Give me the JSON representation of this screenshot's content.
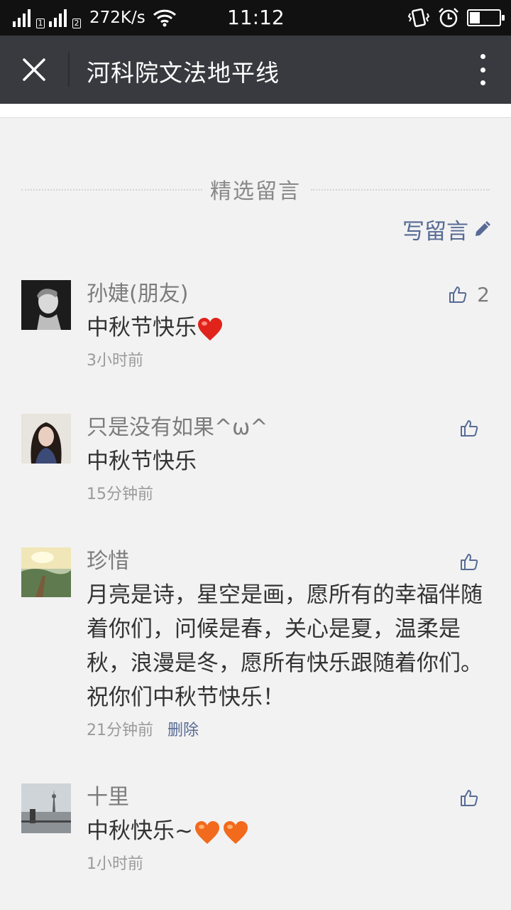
{
  "status_bar": {
    "sim1": "1",
    "sim2": "2",
    "speed": "272K/s",
    "time": "11:12",
    "battery_level": 0.35
  },
  "title_bar": {
    "title": "河科院文法地平线",
    "close_icon": "close-icon",
    "more_icon": "more-vertical-icon"
  },
  "section": {
    "title": "精选留言",
    "write_label": "写留言",
    "write_icon": "pencil-icon"
  },
  "comments": [
    {
      "name": "孙婕(朋友)",
      "text": "中秋节快乐",
      "time": "3小时前",
      "likes": "2",
      "emoji": "heart-red"
    },
    {
      "name": "只是没有如果^ω^",
      "text": "中秋节快乐",
      "time": "15分钟前",
      "likes": ""
    },
    {
      "name": "珍惜",
      "text": "月亮是诗，星空是画，愿所有的幸福伴随着你们，问候是春，关心是夏，温柔是秋，浪漫是冬，愿所有快乐跟随着你们。祝你们中秋节快乐！",
      "time": "21分钟前",
      "likes": "",
      "delete_label": "删除"
    },
    {
      "name": "十里",
      "text": "中秋快乐~",
      "time": "1小时前",
      "likes": "",
      "emoji": "heart-orange-x2"
    }
  ],
  "colors": {
    "titlebar": "#393a3f",
    "link": "#576b95",
    "background": "#f2f2f2"
  }
}
